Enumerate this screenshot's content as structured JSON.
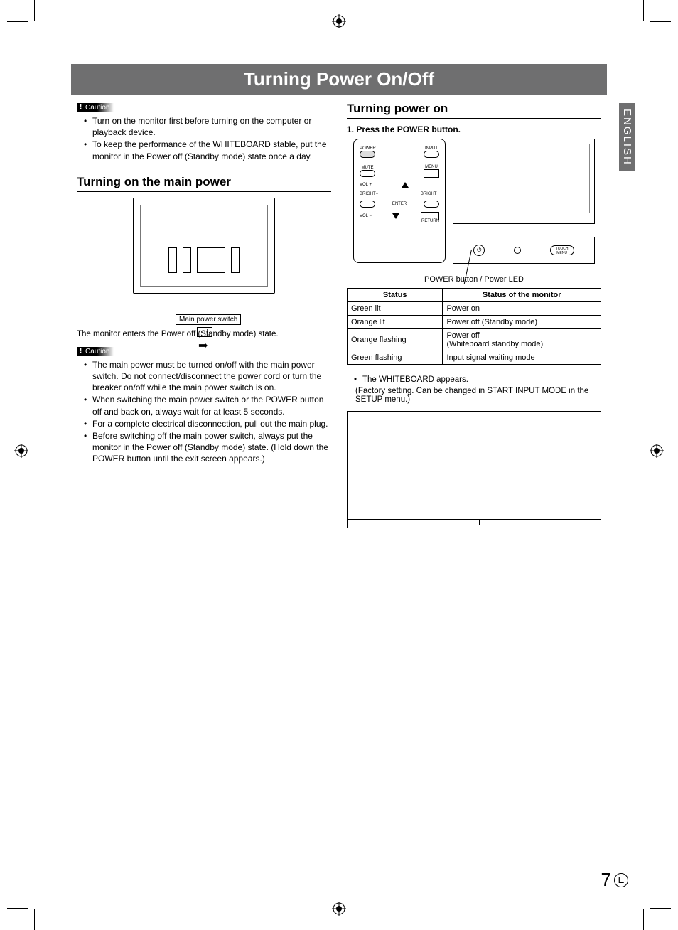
{
  "title": "Turning Power On/Off",
  "language_tab": "ENGLISH",
  "page_number": "7",
  "page_suffix": "E",
  "left": {
    "caution1_label": "Caution",
    "caution1_items": [
      "Turn on the monitor first before turning on the computer or playback device.",
      "To keep the performance of the WHITEBOARD stable, put the monitor in the Power off (Standby mode) state once a day."
    ],
    "section_heading": "Turning on the main power",
    "switch_label": "Main power switch",
    "standby_text": "The monitor enters the Power off (Standby mode) state.",
    "caution2_label": "Caution",
    "caution2_items": [
      "The main power must be turned on/off with the main power switch. Do not connect/disconnect the power cord or turn the breaker on/off while the main power switch is on.",
      "When switching the main power switch or the POWER button off and back on, always wait for at least 5 seconds.",
      "For a complete electrical disconnection, pull out the main plug.",
      "Before switching off the main power switch, always put the monitor in the Power off (Standby mode) state. (Hold down the POWER button until the exit screen appears.)"
    ]
  },
  "right": {
    "section_heading": "Turning power on",
    "step1": "1. Press the POWER button.",
    "remote_labels": {
      "power": "POWER",
      "input": "INPUT",
      "mute": "MUTE",
      "menu": "MENU",
      "vol_up": "VOL +",
      "vol_dn": "VOL −",
      "bright_m": "BRIGHT−",
      "bright_p": "BRIGHT+",
      "enter": "ENTER",
      "return": "RETURN"
    },
    "panel_labels": {
      "touch_menu": "TOUCH MENU"
    },
    "caption": "POWER button / Power LED",
    "table": {
      "head_status": "Status",
      "head_monitor": "Status of the monitor",
      "rows": [
        {
          "s": "Green lit",
          "m": "Power on"
        },
        {
          "s": "Orange lit",
          "m": "Power off (Standby mode)"
        },
        {
          "s": "Orange flashing",
          "m": "Power off\n(Whiteboard standby mode)"
        },
        {
          "s": "Green flashing",
          "m": "Input signal waiting mode"
        }
      ]
    },
    "note_bullet": "The WHITEBOARD appears.",
    "note_sub": "(Factory setting. Can be changed in START INPUT MODE in the SETUP menu.)"
  }
}
